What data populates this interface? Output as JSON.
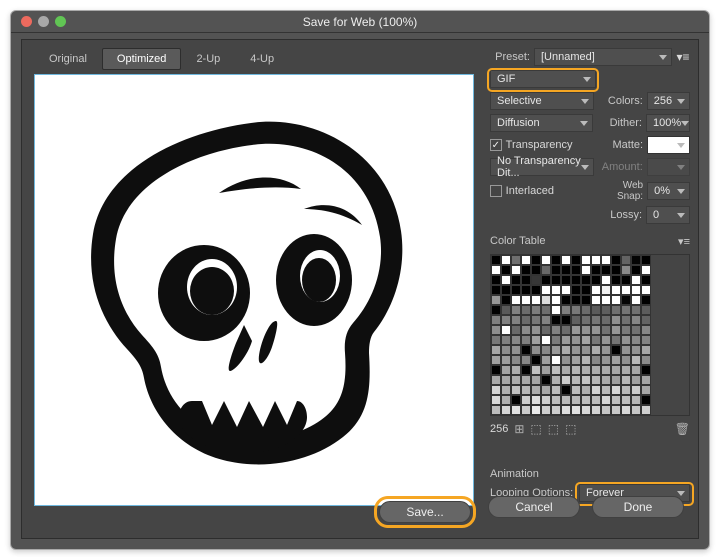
{
  "window": {
    "title": "Save for Web (100%)"
  },
  "traffic": {
    "close": "#ed6a5e",
    "min": "#a8a8a8",
    "zoom": "#61c554"
  },
  "tabs": [
    {
      "label": "Original",
      "active": false
    },
    {
      "label": "Optimized",
      "active": true
    },
    {
      "label": "2-Up",
      "active": false
    },
    {
      "label": "4-Up",
      "active": false
    }
  ],
  "preset": {
    "label": "Preset:",
    "value": "[Unnamed]"
  },
  "format": {
    "value": "GIF"
  },
  "reduction": {
    "value": "Selective"
  },
  "colors": {
    "label": "Colors:",
    "value": "256"
  },
  "dithAlg": {
    "value": "Diffusion"
  },
  "dither": {
    "label": "Dither:",
    "value": "100%"
  },
  "transparency": {
    "label": "Transparency",
    "checked": true
  },
  "matte": {
    "label": "Matte:"
  },
  "transDith": {
    "value": "No Transparency Dit..."
  },
  "amount": {
    "label": "Amount:",
    "value": ""
  },
  "interlaced": {
    "label": "Interlaced",
    "checked": false
  },
  "websnap": {
    "label": "Web Snap:",
    "value": "0%"
  },
  "lossy": {
    "label": "Lossy:",
    "value": "0"
  },
  "colorTable": {
    "label": "Color Table",
    "count": "256"
  },
  "animation": {
    "label": "Animation",
    "looping_label": "Looping Options:",
    "looping_value": "Forever"
  },
  "buttons": {
    "save": "Save...",
    "cancel": "Cancel",
    "done": "Done"
  }
}
